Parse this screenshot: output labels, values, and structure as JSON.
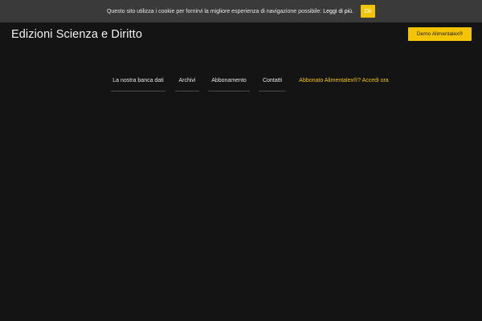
{
  "cookie_bar": {
    "text": "Questo sito utilizza i cookie per fornirvi la migliore esperienza di navigazione possibile:",
    "link_label": "Leggi di più.",
    "ok_label": "Ok"
  },
  "header": {
    "title": "Edizioni Scienza e Diritto",
    "demo_button_label": "Demo Alimentalex®"
  },
  "nav": {
    "items": [
      {
        "label": "La nostra banca dati"
      },
      {
        "label": "Archivi"
      },
      {
        "label": "Abbonamento"
      },
      {
        "label": "Contatti"
      },
      {
        "label": "Abbonato Alimentalex®? Accedi ora"
      }
    ]
  },
  "colors": {
    "background": "#141414",
    "cookie_bar": "#3a3a3a",
    "accent": "#f5c400"
  }
}
